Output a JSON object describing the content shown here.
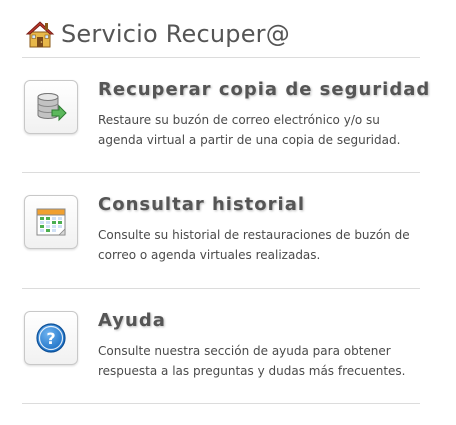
{
  "header": {
    "title": "Servicio Recuper@",
    "icon": "home-icon"
  },
  "items": [
    {
      "icon": "database-restore-icon",
      "title": "Recuperar copia de seguridad",
      "description": "Restaure su buzón de correo electrónico y/o su agenda virtual a partir de una copia de seguridad."
    },
    {
      "icon": "calendar-icon",
      "title": "Consultar historial",
      "description": "Consulte su historial de restauraciones de buzón de correo o agenda virtuales realizadas."
    },
    {
      "icon": "help-icon",
      "title": "Ayuda",
      "description": "Consulte nuestra sección de ayuda para obtener respuesta a las preguntas y dudas más frecuentes."
    }
  ],
  "colors": {
    "title_text": "#555555",
    "description_text": "#4a4a4a",
    "divider": "#dcdcdc",
    "help_blue": "#1a6fc4",
    "calendar_green": "#4caf50",
    "calendar_header": "#f0a030"
  }
}
